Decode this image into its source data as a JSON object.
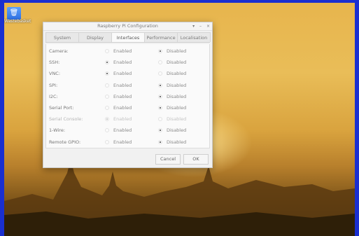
{
  "desktop": {
    "trash_label": "Wastebasket"
  },
  "window": {
    "title": "Raspberry Pi Configuration",
    "controls": [
      "▾",
      "–",
      "×"
    ]
  },
  "tabs": [
    "System",
    "Display",
    "Interfaces",
    "Performance",
    "Localisation"
  ],
  "active_tab": "Interfaces",
  "options": {
    "enabled": "Enabled",
    "disabled": "Disabled"
  },
  "rows": [
    {
      "label": "Camera:",
      "value": "disabled",
      "dim": false
    },
    {
      "label": "SSH:",
      "value": "enabled",
      "dim": false
    },
    {
      "label": "VNC:",
      "value": "enabled",
      "dim": false
    },
    {
      "label": "SPI:",
      "value": "disabled",
      "dim": false
    },
    {
      "label": "I2C:",
      "value": "disabled",
      "dim": false
    },
    {
      "label": "Serial Port:",
      "value": "disabled",
      "dim": false
    },
    {
      "label": "Serial Console:",
      "value": "enabled",
      "dim": true
    },
    {
      "label": "1-Wire:",
      "value": "disabled",
      "dim": false
    },
    {
      "label": "Remote GPIO:",
      "value": "disabled",
      "dim": false
    }
  ],
  "buttons": {
    "cancel": "Cancel",
    "ok": "OK"
  }
}
